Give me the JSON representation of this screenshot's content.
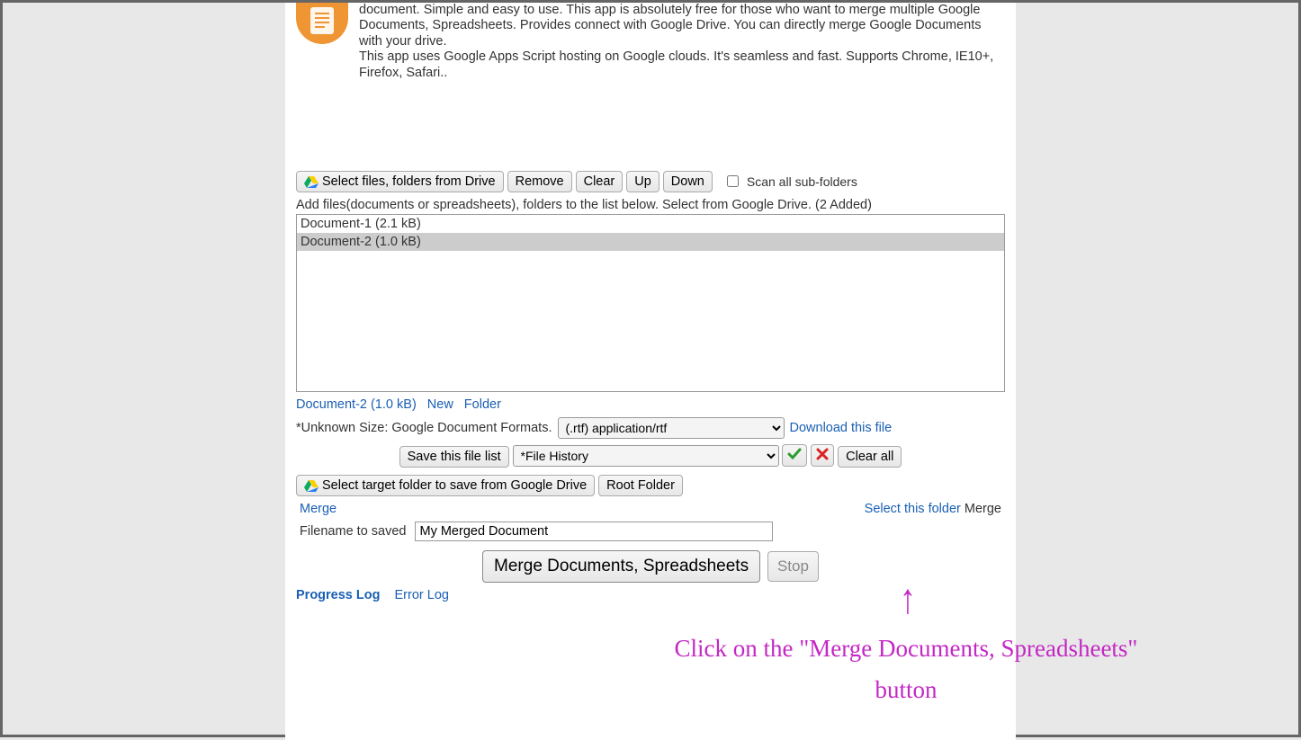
{
  "description": {
    "p1": "document. Simple and easy to use. This app is absolutely free for those who want to merge multiple Google Documents, Spreadsheets. Provides connect with Google Drive. You can directly merge Google Documents with your drive.",
    "p2": "This app uses Google Apps Script hosting on Google clouds. It's seamless and fast. Supports Chrome, IE10+, Firefox, Safari.."
  },
  "toolbar": {
    "select_files": "Select files, folders from Drive",
    "remove": "Remove",
    "clear": "Clear",
    "up": "Up",
    "down": "Down",
    "scan_sub": "Scan all sub-folders"
  },
  "hint": "Add files(documents or spreadsheets), folders to the list below. Select from Google Drive. (2 Added)",
  "files": [
    {
      "label": "Document-1 (2.1 kB)",
      "selected": false
    },
    {
      "label": "Document-2 (1.0 kB)",
      "selected": true
    }
  ],
  "below": {
    "selected_file": "Document-2 (1.0 kB)",
    "new_link": "New",
    "folder_link": "Folder"
  },
  "format_row": {
    "label": "*Unknown Size: Google Document Formats.",
    "select_value": "(.rtf) application/rtf",
    "download": "Download this file"
  },
  "history_row": {
    "save_list": "Save this file list",
    "history_value": "*File History",
    "clear_all": "Clear all"
  },
  "target_row": {
    "select_target": "Select target folder to save from Google Drive",
    "root": "Root Folder"
  },
  "merge_row": {
    "left": "Merge",
    "right_link": "Select this folder",
    "right_text": "Merge"
  },
  "filename_row": {
    "label": "Filename to saved",
    "value": "My Merged Document"
  },
  "actions": {
    "merge": "Merge Documents, Spreadsheets",
    "stop": "Stop"
  },
  "logs": {
    "progress": "Progress Log",
    "error": "Error Log"
  },
  "annotation": "Click on the \"Merge Documents, Spreadsheets\" button"
}
